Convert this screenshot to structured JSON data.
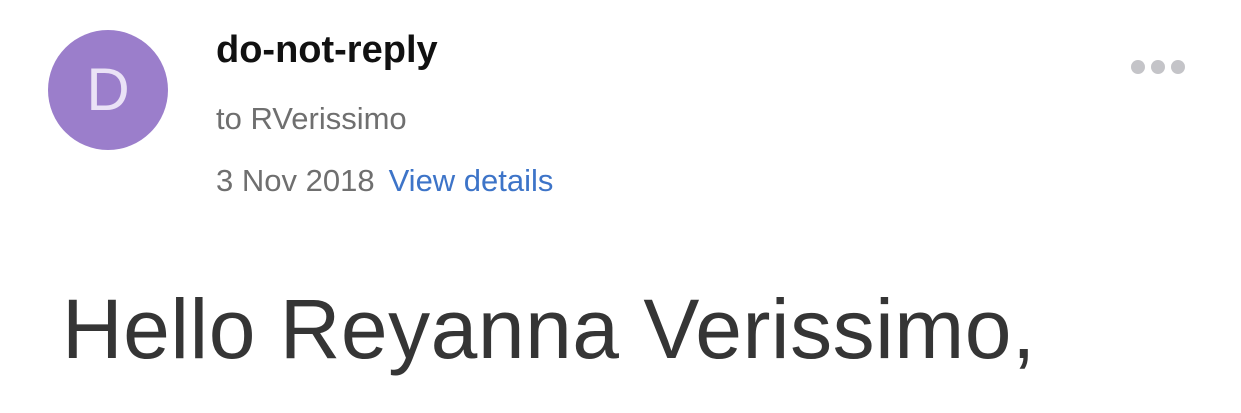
{
  "email": {
    "avatar_letter": "D",
    "sender": "do-not-reply",
    "recipient": "to RVerissimo",
    "date": "3 Nov 2018",
    "view_details_label": "View details",
    "more_icon": "more-horizontal-icon"
  },
  "body": {
    "greeting": "Hello Reyanna Verissimo,"
  },
  "colors": {
    "avatar_bg": "#9b7ecb",
    "link": "#3d74c8",
    "more_dots": "#c4c4c8"
  }
}
